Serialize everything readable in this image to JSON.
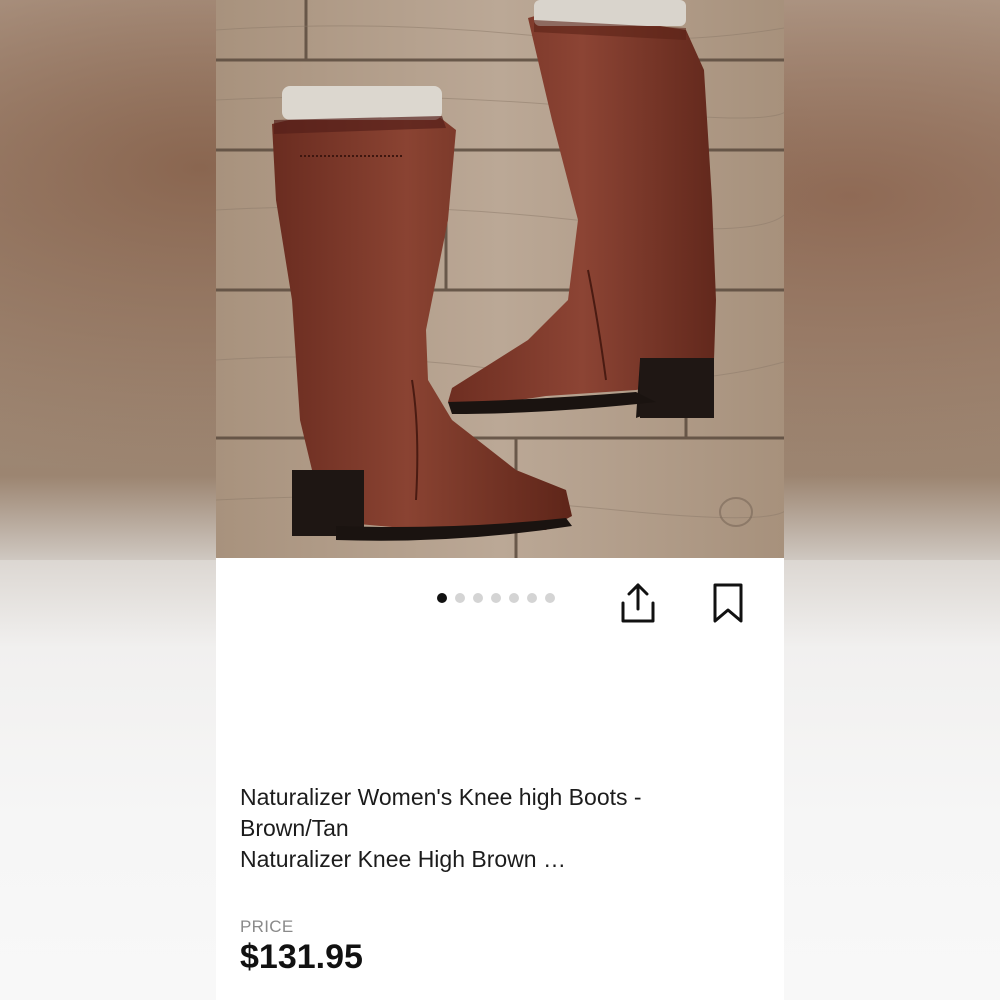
{
  "product": {
    "title_line1": "Naturalizer Women's Knee high Boots -",
    "title_line2": "Brown/Tan",
    "title_line3": "Naturalizer Knee High Brown …",
    "image_alt": "Brown leather knee-high boots on wood floor"
  },
  "carousel": {
    "total": 7,
    "active_index": 0
  },
  "actions": {
    "share_icon": "share-icon",
    "bookmark_icon": "bookmark-icon"
  },
  "price": {
    "label": "PRICE",
    "value": "$131.95"
  },
  "colors": {
    "boot_leather": "#7a3526",
    "boot_heel": "#1c1512",
    "floor_wood": "#b39f8c",
    "text_primary": "#1c1c1c",
    "text_muted": "#8a8a8a",
    "dot_active": "#111111",
    "dot_inactive": "#d4d4d4"
  }
}
